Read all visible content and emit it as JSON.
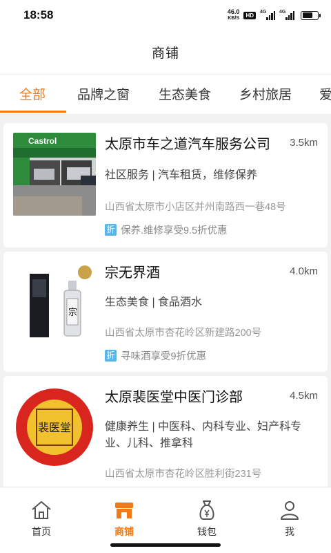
{
  "status": {
    "time": "18:58",
    "net_speed": "46.0",
    "net_unit": "KB/S",
    "hd": "HD",
    "sig1": "4G",
    "sig2": "4G",
    "battery_level": 0.7
  },
  "header": {
    "title": "商铺"
  },
  "tabs": [
    {
      "label": "全部",
      "active": true
    },
    {
      "label": "品牌之窗"
    },
    {
      "label": "生态美食"
    },
    {
      "label": "乡村旅居"
    },
    {
      "label": "爱"
    }
  ],
  "shops": [
    {
      "name": "太原市车之道汽车服务公司",
      "distance": "3.5km",
      "category": "社区服务 | 汽车租赁，维修保养",
      "address": "山西省太原市小店区并州南路西一巷48号",
      "promo_icon": "折",
      "promo": "保养.维修享受9.5折优惠",
      "image_text": "Castrol"
    },
    {
      "name": "宗无界酒",
      "distance": "4.0km",
      "category": "生态美食 | 食品酒水",
      "address": "山西省太原市杏花岭区新建路200号",
      "promo_icon": "折",
      "promo": "寻味酒享受9折优惠",
      "image_text": "宗"
    },
    {
      "name": "太原裴医堂中医门诊部",
      "distance": "4.5km",
      "category": "健康养生 | 中医科、内科专业、妇产科专业、儿科、推拿科",
      "address": "山西省太原市杏花岭区胜利街231号",
      "image_text": "裴医堂"
    }
  ],
  "nav": [
    {
      "label": "首页",
      "icon": "home-icon"
    },
    {
      "label": "商铺",
      "icon": "shop-icon",
      "active": true
    },
    {
      "label": "钱包",
      "icon": "wallet-icon"
    },
    {
      "label": "我",
      "icon": "user-icon"
    }
  ],
  "colors": {
    "accent": "#f07a18",
    "promo_icon": "#5bb5e8"
  }
}
